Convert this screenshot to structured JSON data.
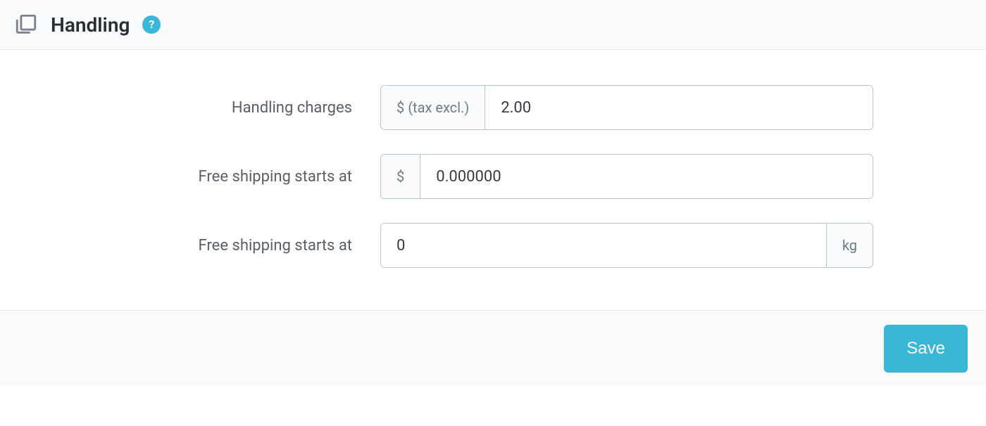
{
  "header": {
    "title": "Handling",
    "help_symbol": "?"
  },
  "form": {
    "handling_charges": {
      "label": "Handling charges",
      "prefix": "$ (tax excl.)",
      "value": "2.00"
    },
    "free_shipping_price": {
      "label": "Free shipping starts at",
      "prefix": "$",
      "value": "0.000000"
    },
    "free_shipping_weight": {
      "label": "Free shipping starts at",
      "suffix": "kg",
      "value": "0"
    }
  },
  "footer": {
    "save_label": "Save"
  }
}
